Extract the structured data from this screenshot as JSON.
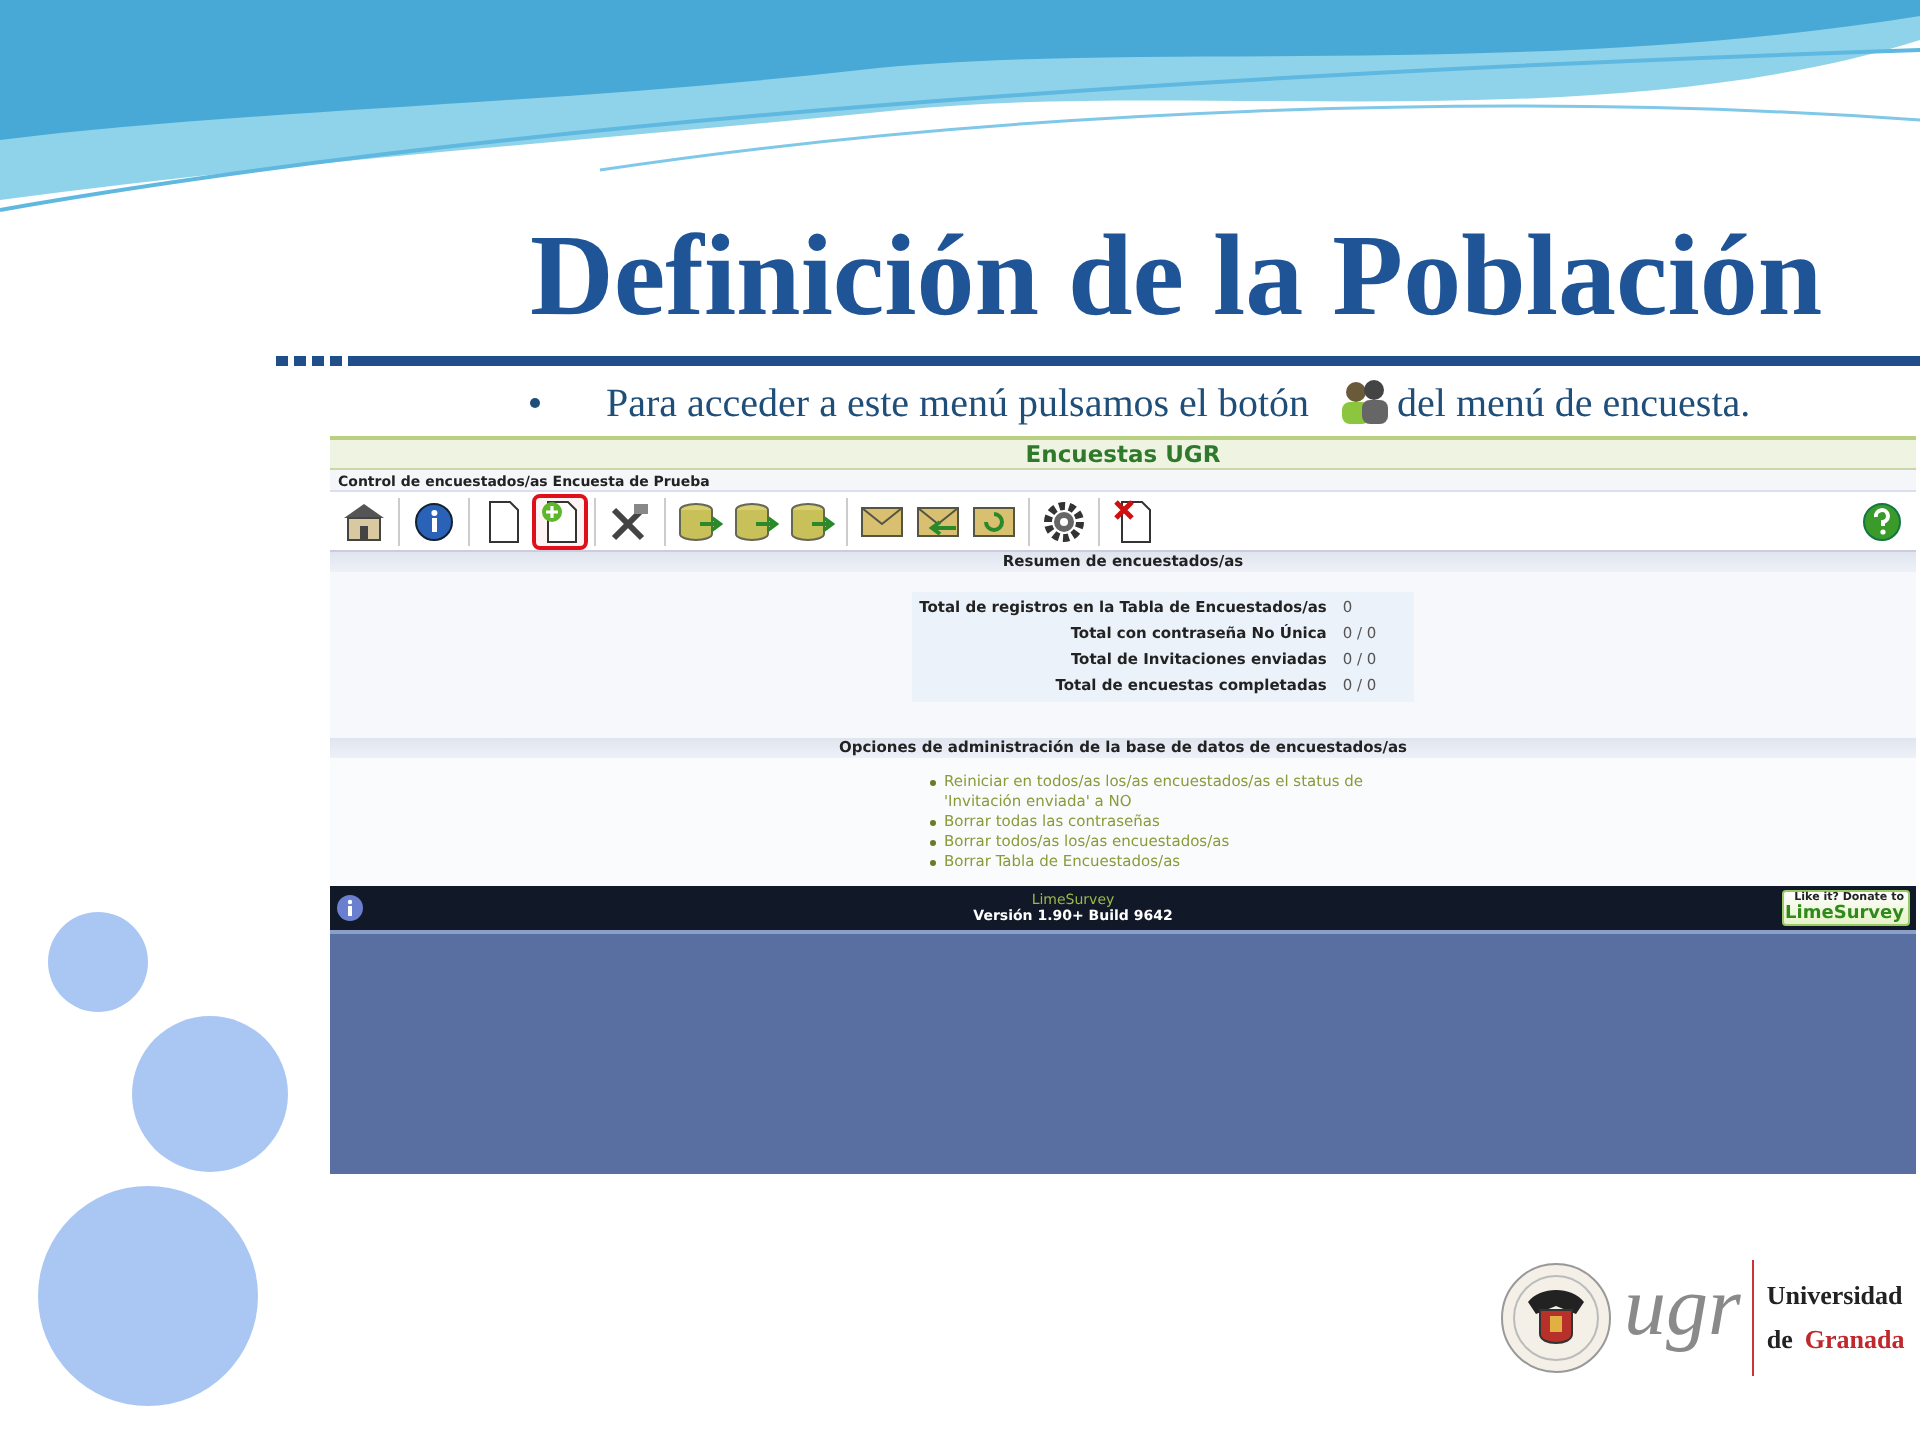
{
  "slide": {
    "title": "Definición de la Población",
    "bullet_before": "Para acceder a este menú pulsamos el botón",
    "bullet_after": "del menú de encuesta."
  },
  "app": {
    "header": "Encuestas UGR",
    "breadcrumb": "Control de encuestados/as Encuesta de Prueba",
    "toolbar_groups": [
      [
        {
          "kind": "home",
          "selected": false
        }
      ],
      [
        {
          "kind": "info",
          "selected": false
        }
      ],
      [
        {
          "kind": "document",
          "selected": false
        },
        {
          "kind": "document-add",
          "selected": true
        }
      ],
      [
        {
          "kind": "tools",
          "selected": false
        }
      ],
      [
        {
          "kind": "database",
          "selected": false
        },
        {
          "kind": "database",
          "selected": false
        },
        {
          "kind": "database",
          "selected": false
        }
      ],
      [
        {
          "kind": "envelope",
          "selected": false
        },
        {
          "kind": "envelope-arrow",
          "selected": false
        },
        {
          "kind": "envelope-refresh",
          "selected": false
        }
      ],
      [
        {
          "kind": "gear",
          "selected": false
        }
      ],
      [
        {
          "kind": "document-delete",
          "selected": false
        }
      ]
    ],
    "summary": {
      "heading": "Resumen de encuestados/as",
      "rows": [
        {
          "label": "Total de registros en la Tabla de Encuestados/as",
          "value": "0"
        },
        {
          "label": "Total con contraseña No Única",
          "value": "0 / 0"
        },
        {
          "label": "Total de Invitaciones enviadas",
          "value": "0 / 0"
        },
        {
          "label": "Total de encuestas completadas",
          "value": "0 / 0"
        }
      ]
    },
    "options": {
      "heading": "Opciones de administración de la base de datos de encuestados/as",
      "items": [
        "Reiniciar en todos/as los/as encuestados/as el status de 'Invitación enviada' a NO",
        "Borrar todas las contraseñas",
        "Borrar todos/as los/as encuestados/as",
        "Borrar Tabla de Encuestados/as"
      ]
    },
    "footer": {
      "name": "LimeSurvey",
      "version": "Versión 1.90+ Build 9642",
      "donate_top": "Like it? Donate to",
      "donate_brand": "LimeSurvey"
    }
  },
  "logo": {
    "mark": "ugr",
    "line1": "Universidad",
    "line2_a": "de",
    "line2_b": "Granada"
  }
}
